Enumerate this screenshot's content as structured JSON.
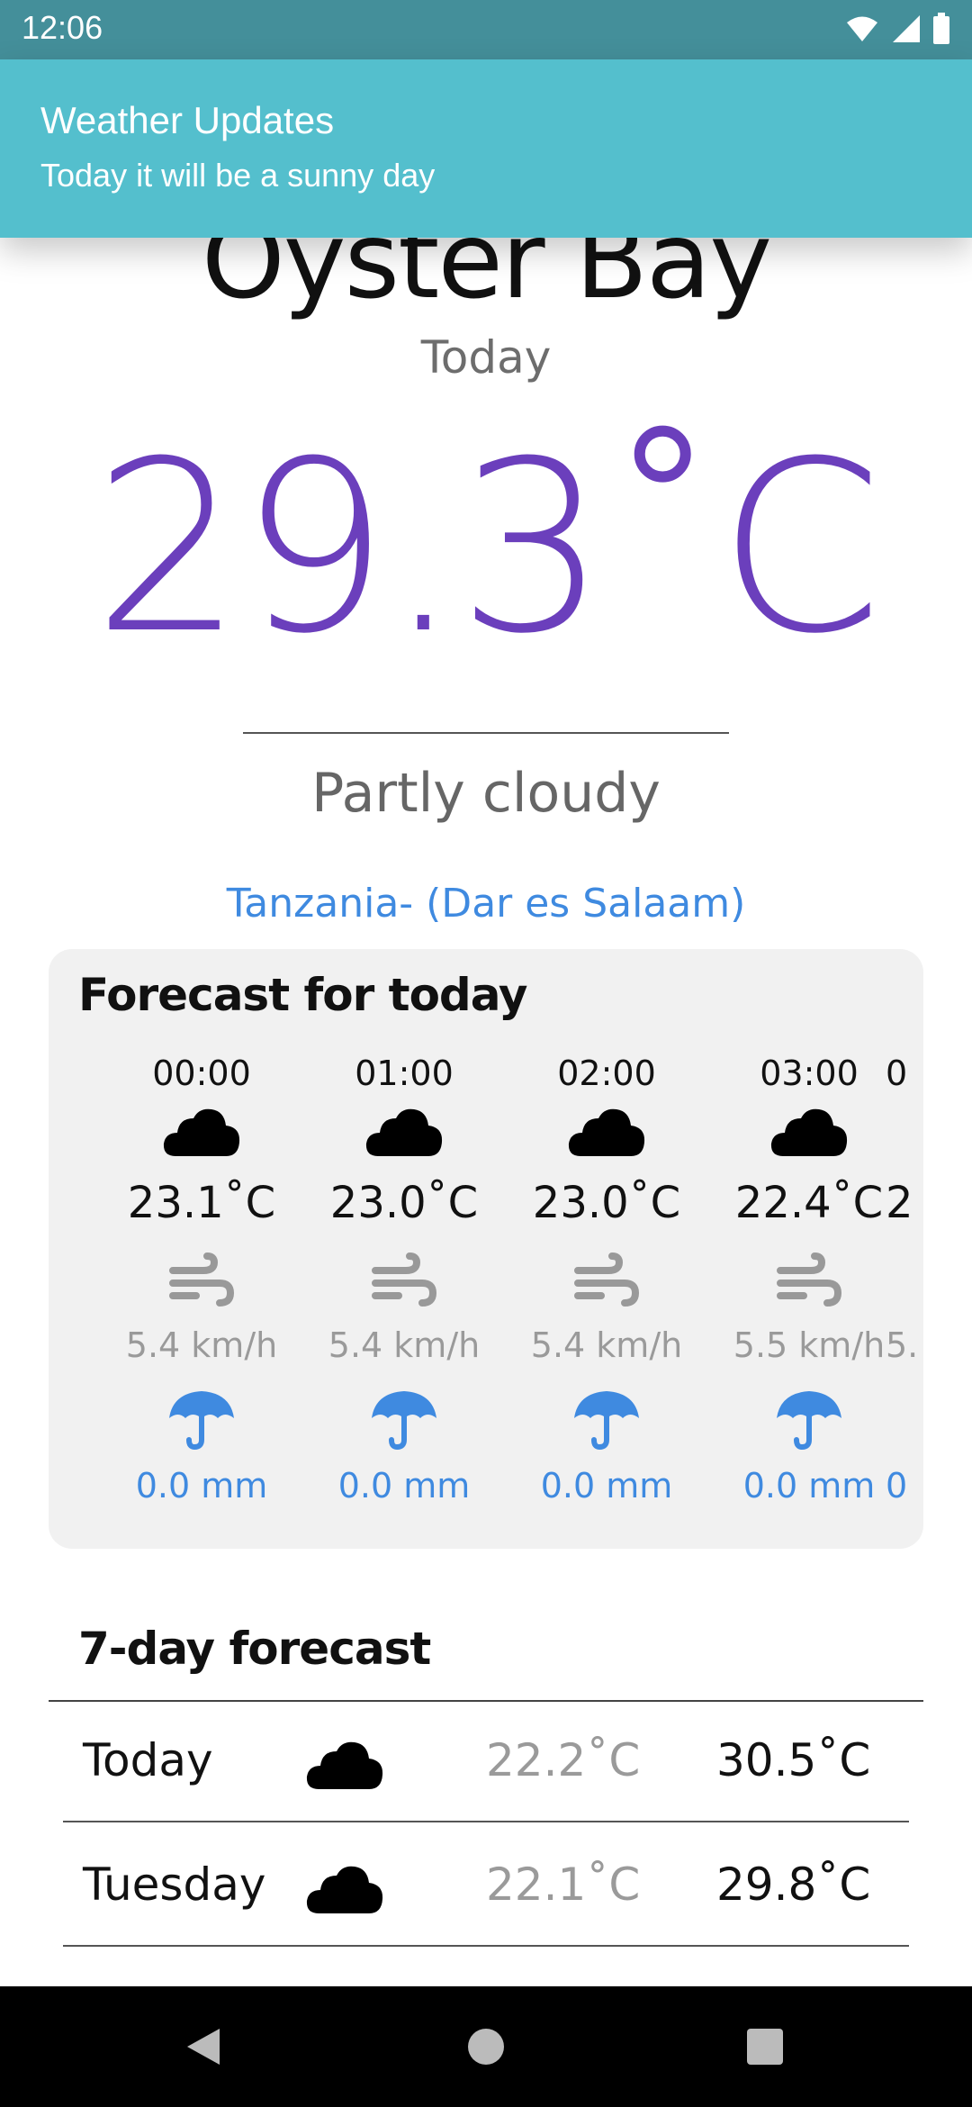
{
  "status_bar": {
    "time": "12:06",
    "icons": [
      "wifi-icon",
      "signal-icon",
      "battery-icon"
    ]
  },
  "notification": {
    "title": "Weather Updates",
    "text": "Today it will be a sunny day"
  },
  "city": "Oyster Bay",
  "day_label": "Today",
  "current_temp": "29.3˚C",
  "condition": "Partly cloudy",
  "location": "Tanzania- (Dar es Salaam)",
  "hourly": {
    "title": "Forecast for today",
    "items": [
      {
        "time": "00:00",
        "temp": "23.1˚C",
        "wind": "5.4 km/h",
        "rain": "0.0 mm",
        "icon": "cloud-icon"
      },
      {
        "time": "01:00",
        "temp": "23.0˚C",
        "wind": "5.4 km/h",
        "rain": "0.0 mm",
        "icon": "cloud-icon"
      },
      {
        "time": "02:00",
        "temp": "23.0˚C",
        "wind": "5.4 km/h",
        "rain": "0.0 mm",
        "icon": "cloud-icon"
      },
      {
        "time": "03:00",
        "temp": "22.4˚C",
        "wind": "5.5 km/h",
        "rain": "0.0 mm",
        "icon": "cloud-icon"
      },
      {
        "time": "0",
        "temp": "2",
        "wind": "5.",
        "rain": "0",
        "icon": "cloud-icon"
      }
    ]
  },
  "weekly": {
    "title": "7-day forecast",
    "days": [
      {
        "name": "Today",
        "low": "22.2˚C",
        "high": "30.5˚C",
        "icon": "cloud-icon"
      },
      {
        "name": "Tuesday",
        "low": "22.1˚C",
        "high": "29.8˚C",
        "icon": "cloud-icon"
      }
    ]
  },
  "colors": {
    "accent_temp": "#6b3fbc",
    "link_blue": "#3f8ae0",
    "banner": "#54bfcd",
    "status_bar": "#448f9a"
  },
  "nav_bar": {
    "icons": [
      "back-icon",
      "home-icon",
      "recents-icon"
    ]
  }
}
